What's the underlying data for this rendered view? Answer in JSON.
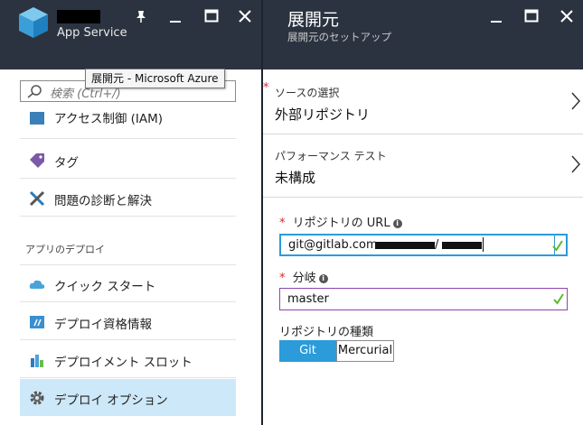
{
  "left_blade": {
    "app_name_redacted": true,
    "app_type": "App Service",
    "controls": {
      "pin_icon": "pin-icon",
      "minimize_icon": "minimize-icon",
      "maximize_icon": "maximize-icon",
      "close_icon": "close-icon"
    }
  },
  "tooltip": "展開元 - Microsoft Azure",
  "search": {
    "placeholder": "検索 (Ctrl+/)"
  },
  "menu": {
    "items": [
      {
        "label": "アクセス制御 (IAM)",
        "icon": "people-icon",
        "clipped": true
      },
      {
        "label": "タグ",
        "icon": "tag-icon"
      },
      {
        "label": "問題の診断と解決",
        "icon": "wrench-icon"
      }
    ],
    "section_label": "アプリのデプロイ",
    "deploy_items": [
      {
        "label": "クイック スタート",
        "icon": "cloud-icon"
      },
      {
        "label": "デプロイ資格情報",
        "icon": "credentials-icon"
      },
      {
        "label": "デプロイメント スロット",
        "icon": "slots-icon"
      },
      {
        "label": "デプロイ オプション",
        "icon": "gear-icon",
        "selected": true
      }
    ]
  },
  "right_blade": {
    "title": "展開元",
    "subtitle": "展開元のセットアップ",
    "source": {
      "required_mark": "*",
      "label": "ソースの選択",
      "value": "外部リポジトリ"
    },
    "perf": {
      "label": "パフォーマンス テスト",
      "value": "未構成"
    },
    "repo_url": {
      "required_mark": "*",
      "label": "リポジトリの URL",
      "value": "git@gitlab.com:"
    },
    "branch": {
      "required_mark": "*",
      "label": "分岐",
      "value": "master"
    },
    "repo_type": {
      "label": "リポジトリの種類",
      "options": [
        "Git",
        "Mercurial"
      ],
      "selected": "Git"
    }
  },
  "colors": {
    "header_bg": "#2b3340",
    "selected_bg": "#cde8f8",
    "accent_blue": "#2b9bd9",
    "valid_green": "#5cb82b",
    "focus_purple": "#8e44ad",
    "required_red": "#d8262b"
  }
}
